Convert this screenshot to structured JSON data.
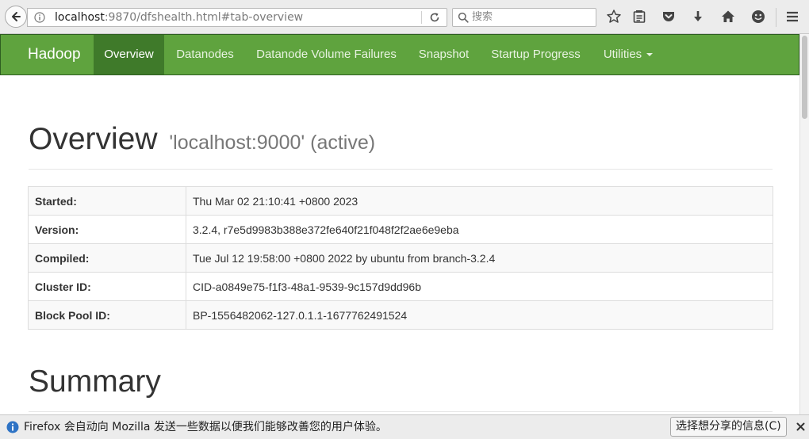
{
  "browser": {
    "url_host": "localhost",
    "url_rest": ":9870/dfshealth.html#tab-overview",
    "search_placeholder": "搜索"
  },
  "navbar": {
    "brand": "Hadoop",
    "items": [
      {
        "label": "Overview",
        "active": true
      },
      {
        "label": "Datanodes"
      },
      {
        "label": "Datanode Volume Failures"
      },
      {
        "label": "Snapshot"
      },
      {
        "label": "Startup Progress"
      },
      {
        "label": "Utilities",
        "dropdown": true
      }
    ]
  },
  "overview": {
    "title": "Overview",
    "subtitle": "'localhost:9000' (active)",
    "rows": [
      {
        "key": "Started:",
        "value": "Thu Mar 02 21:10:41 +0800 2023"
      },
      {
        "key": "Version:",
        "value": "3.2.4, r7e5d9983b388e372fe640f21f048f2f2ae6e9eba"
      },
      {
        "key": "Compiled:",
        "value": "Tue Jul 12 19:58:00 +0800 2022 by ubuntu from branch-3.2.4"
      },
      {
        "key": "Cluster ID:",
        "value": "CID-a0849e75-f1f3-48a1-9539-9c157d9dd96b"
      },
      {
        "key": "Block Pool ID:",
        "value": "BP-1556482062-127.0.1.1-1677762491524"
      }
    ]
  },
  "summary": {
    "title": "Summary"
  },
  "notification": {
    "text": "Firefox 会自动向 Mozilla 发送一些数据以便我们能够改善您的用户体验。",
    "button": "选择想分享的信息(C)"
  },
  "colors": {
    "navbar": "#5fa33e",
    "nav_active": "#3f7a2a"
  }
}
